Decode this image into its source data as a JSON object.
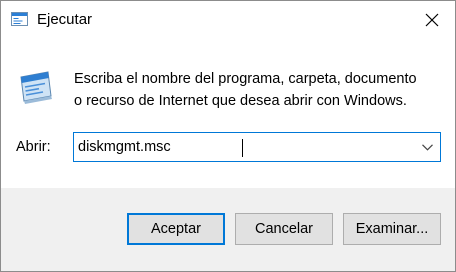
{
  "window": {
    "title": "Ejecutar",
    "icon": "run-dialog-icon",
    "close_icon": "close-icon"
  },
  "content": {
    "description_line1": "Escriba el nombre del programa, carpeta, documento",
    "description_line2": "o recurso de Internet que desea abrir con Windows.",
    "open_label": "Abrir:",
    "input_value": "diskmgmt.msc"
  },
  "buttons": {
    "ok": "Aceptar",
    "cancel": "Cancelar",
    "browse": "Examinar..."
  },
  "colors": {
    "accent": "#0078d7",
    "footer_bg": "#f0f0f0",
    "button_bg": "#e1e1e1"
  }
}
